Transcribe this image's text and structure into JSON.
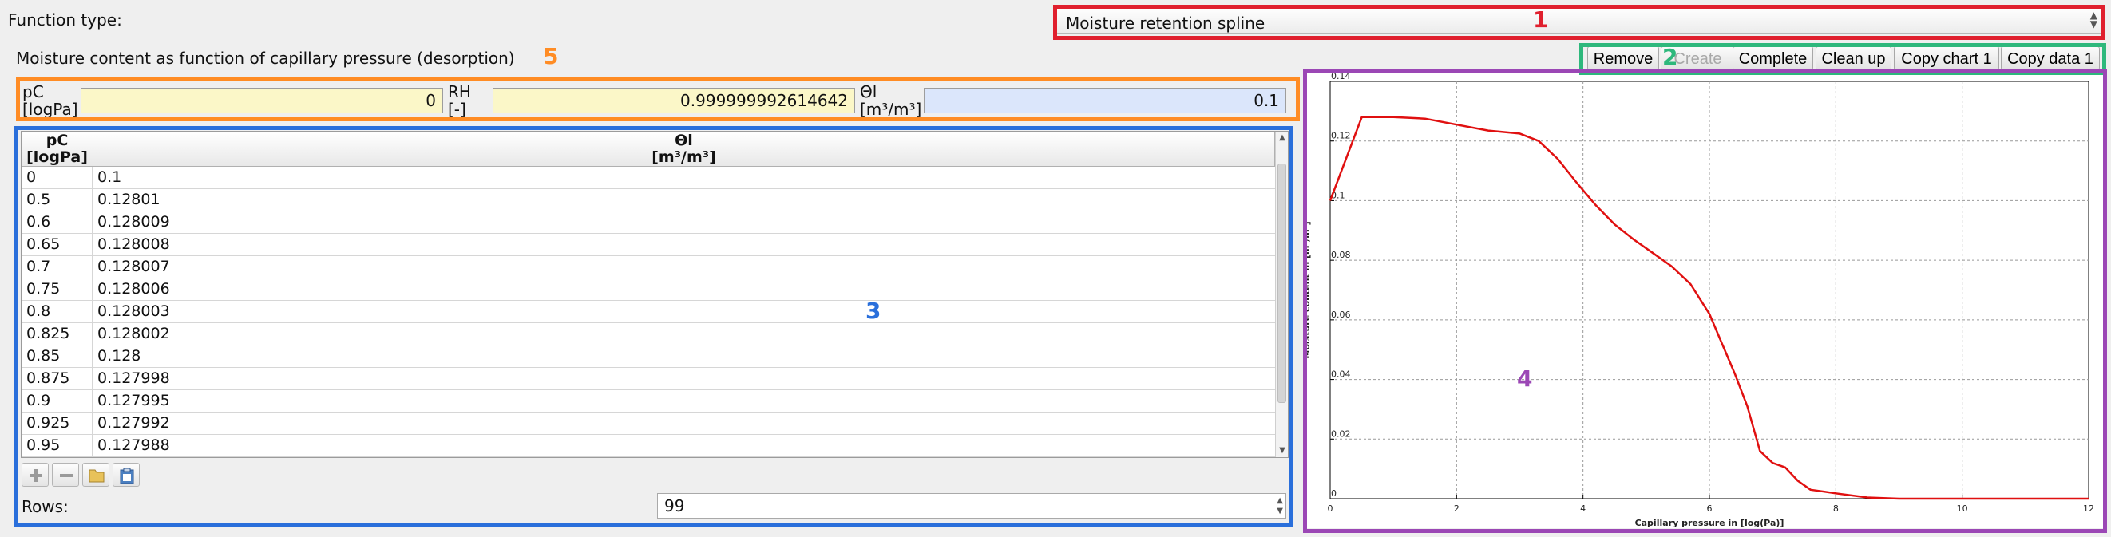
{
  "function_type": {
    "label": "Function type:",
    "selected": "Moisture retention spline"
  },
  "toolbar": {
    "remove": "Remove",
    "create": "Create",
    "complete": "Complete",
    "clean_up": "Clean up",
    "copy_chart": "Copy chart 1",
    "copy_data": "Copy data 1"
  },
  "section_title": "Moisture content as function of capillary pressure (desorption)",
  "value_fields": {
    "pc_label_line1": "pC",
    "pc_label_line2": "[logPa]",
    "pc_value": "0",
    "rh_label_line1": "RH",
    "rh_label_line2": "[-]",
    "rh_value": "0.999999992614642",
    "theta_label_line1": "Θl",
    "theta_label_line2": "[m³/m³]",
    "theta_value": "0.1"
  },
  "table": {
    "col1_header_line1": "pC",
    "col1_header_line2": "[logPa]",
    "col2_header_line1": "Θl",
    "col2_header_line2": "[m³/m³]",
    "rows": [
      {
        "pc": "0",
        "theta": "0.1"
      },
      {
        "pc": "0.5",
        "theta": "0.12801"
      },
      {
        "pc": "0.6",
        "theta": "0.128009"
      },
      {
        "pc": "0.65",
        "theta": "0.128008"
      },
      {
        "pc": "0.7",
        "theta": "0.128007"
      },
      {
        "pc": "0.75",
        "theta": "0.128006"
      },
      {
        "pc": "0.8",
        "theta": "0.128003"
      },
      {
        "pc": "0.825",
        "theta": "0.128002"
      },
      {
        "pc": "0.85",
        "theta": "0.128"
      },
      {
        "pc": "0.875",
        "theta": "0.127998"
      },
      {
        "pc": "0.9",
        "theta": "0.127995"
      },
      {
        "pc": "0.925",
        "theta": "0.127992"
      },
      {
        "pc": "0.95",
        "theta": "0.127988"
      }
    ],
    "rows_label": "Rows:",
    "rows_value": "99"
  },
  "icons": {
    "add": "plus-icon",
    "remove": "minus-icon",
    "open": "folder-icon",
    "paste": "paste-icon"
  },
  "annotations": {
    "n1": "1",
    "n2": "2",
    "n3": "3",
    "n4": "4",
    "n5": "5",
    "colors": {
      "1": "#e0202e",
      "2": "#2eb87c",
      "3": "#2a6fdb",
      "4": "#9b47b5",
      "5": "#ff8c24"
    }
  },
  "chart_data": {
    "type": "line",
    "title": "",
    "xlabel": "Capillary pressure in [log(Pa)]",
    "ylabel": "Moisture content in [m³/m³]",
    "xlim": [
      0,
      12
    ],
    "ylim": [
      0,
      0.14
    ],
    "xticks": [
      "0",
      "2",
      "4",
      "6",
      "8",
      "10",
      "12"
    ],
    "yticks": [
      "0",
      "0.02",
      "0.04",
      "0.06",
      "0.08",
      "0.1",
      "0.12",
      "0.14"
    ],
    "grid": true,
    "line_color": "#e01010",
    "series": [
      {
        "x": [
          0,
          0.5,
          1.0,
          1.5,
          2.0,
          2.5,
          3.0,
          3.3,
          3.6,
          3.9,
          4.2,
          4.5,
          4.8,
          5.1,
          5.4,
          5.7,
          6.0,
          6.2,
          6.4,
          6.6,
          6.8,
          7.0,
          7.2,
          7.4,
          7.6,
          8.0,
          8.5,
          9.0,
          10.0,
          11.0,
          12.0
        ],
        "y": [
          0.1,
          0.128,
          0.128,
          0.1275,
          0.1255,
          0.1235,
          0.1225,
          0.12,
          0.114,
          0.106,
          0.0985,
          0.092,
          0.087,
          0.0825,
          0.078,
          0.072,
          0.062,
          0.052,
          0.042,
          0.031,
          0.016,
          0.012,
          0.0105,
          0.006,
          0.003,
          0.0018,
          0.0004,
          0,
          0,
          0,
          0
        ]
      }
    ]
  }
}
